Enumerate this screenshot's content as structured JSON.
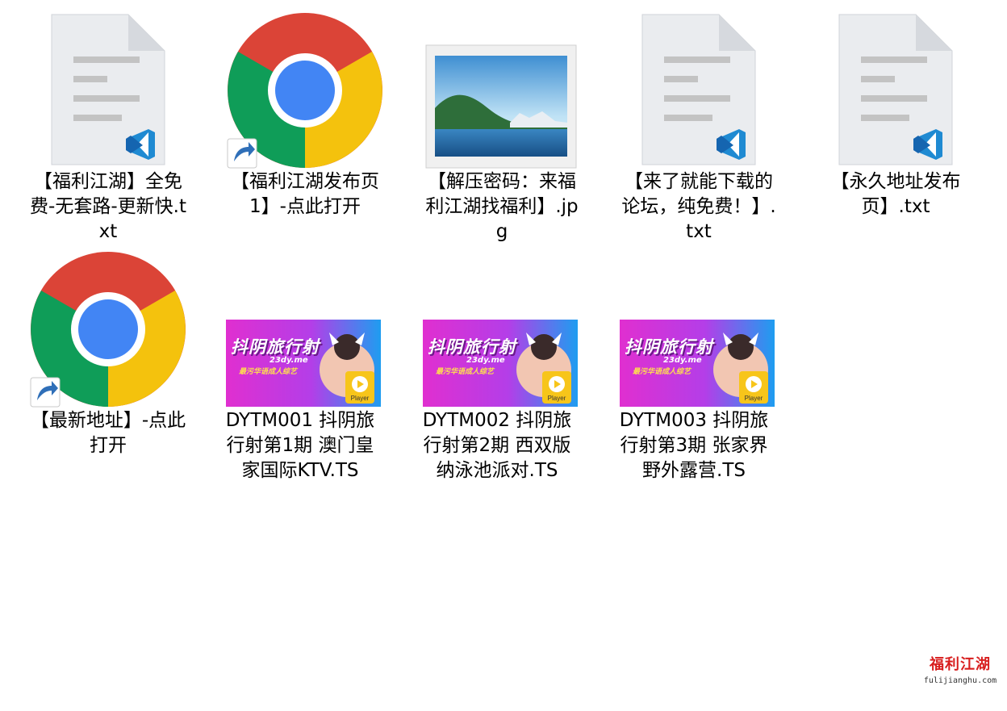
{
  "files": [
    {
      "name": "【福利江湖】全免费-无套路-更新快.txt",
      "icon": "vscode-text-file-icon"
    },
    {
      "name": "【福利江湖发布页1】-点此打开",
      "icon": "chrome-shortcut-icon"
    },
    {
      "name": "【解压密码：来福利江湖找福利】.jpg",
      "icon": "image-file-icon"
    },
    {
      "name": "【来了就能下载的论坛，纯免费！】.txt",
      "icon": "vscode-text-file-icon"
    },
    {
      "name": "【永久地址发布页】.txt",
      "icon": "vscode-text-file-icon"
    },
    {
      "name": "【最新地址】-点此打开",
      "icon": "chrome-shortcut-icon"
    },
    {
      "name": "DYTM001 抖阴旅行射第1期 澳门皇家国际KTV.TS",
      "icon": "video-thumbnail-icon"
    },
    {
      "name": "DYTM002 抖阴旅行射第2期 西双版纳泳池派对.TS",
      "icon": "video-thumbnail-icon"
    },
    {
      "name": "DYTM003 抖阴旅行射第3期 张家界野外露营.TS",
      "icon": "video-thumbnail-icon"
    }
  ],
  "thumbnail": {
    "title": "抖阴旅行射",
    "domain": "23dy.me",
    "tagline": "最污华语成人综艺",
    "badge": "Player"
  },
  "watermark": {
    "name": "福利江湖",
    "url": "fulijianghu.com"
  },
  "colors": {
    "text": "#000000",
    "vscode_blue": "#1f8ad2",
    "chrome_red": "#db4437",
    "chrome_yellow": "#f4c20d",
    "chrome_green": "#0f9d58",
    "chrome_blue": "#4285f4",
    "thumb_gradient_start": "#e02fd0",
    "thumb_gradient_end": "#1e9df0",
    "watermark_red": "#d81e1e"
  }
}
